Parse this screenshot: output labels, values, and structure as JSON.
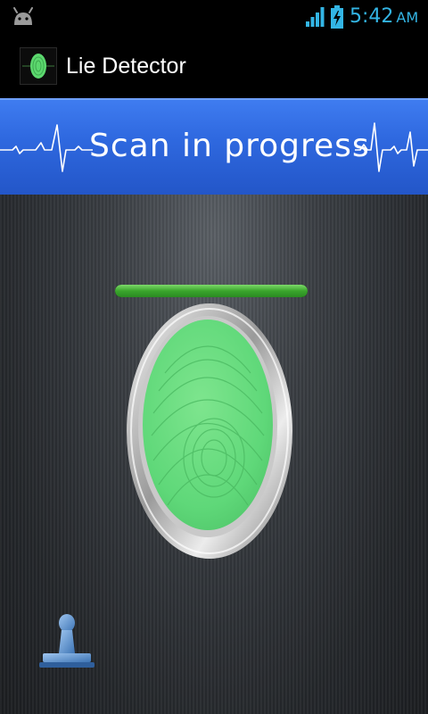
{
  "status_bar": {
    "time": "5:42",
    "ampm": "AM",
    "icons": [
      "android-icon",
      "signal-icon",
      "battery-charging-icon"
    ],
    "accent_color": "#33b5e5"
  },
  "action_bar": {
    "title": "Lie Detector",
    "icon": "fingerprint-app-icon"
  },
  "banner": {
    "text": "Scan in progress",
    "background_color": "#2f69e0",
    "decoration": "heartbeat-wave-icon"
  },
  "scanner": {
    "progress": 1.0,
    "progress_color": "#3aa52c",
    "pad_color": "#5fd879",
    "icon": "fingerprint-scanner-icon"
  },
  "controls": {
    "stamp_icon": "stamp-icon"
  }
}
